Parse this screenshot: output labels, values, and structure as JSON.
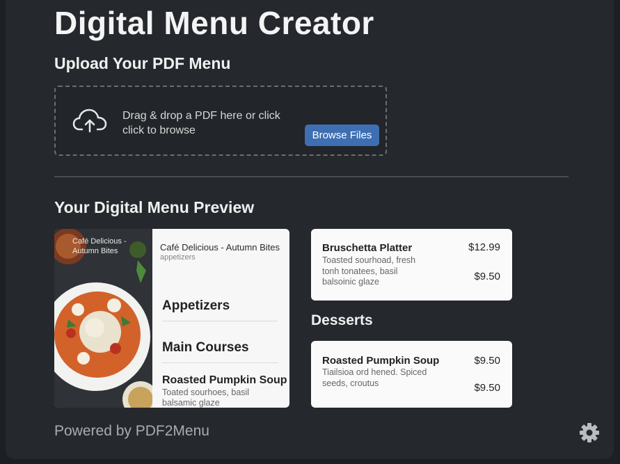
{
  "app": {
    "title": "Digital Menu Creator"
  },
  "upload": {
    "heading": "Upload Your PDF Menu",
    "drop_text": "Drag & drop a PDF here or click click to browse",
    "browse_label": "Browse Files",
    "icon": "cloud-upload-icon"
  },
  "preview": {
    "heading": "Your Digital Menu Preview",
    "image_caption": "Café Delicious - Autumn Bites",
    "menu_title": "Café Delicious - Autumn Bites",
    "menu_subtitle": "appetizers",
    "sections": [
      "Appetizers",
      "Main Courses"
    ],
    "item": {
      "name": "Roasted Pumpkin Soup",
      "desc": "Toated sourhoes, basil balsamic glaze"
    }
  },
  "cards": [
    {
      "name": "Bruschetta Platter",
      "price_top": "$12.99",
      "desc": "Toasted sourhoad, fresh tonh tonatees, basil balsoinic glaze",
      "price_bottom": "$9.50"
    },
    {
      "name": "Roasted Pumpkin Soup",
      "price_top": "$9.50",
      "desc": "Tiailsioa ord hened. Spiced seeds, croutus",
      "price_bottom": "$9.50"
    }
  ],
  "desserts_heading": "Desserts",
  "footer": {
    "text": "Powered by PDF2Menu",
    "settings_icon": "gear-icon"
  },
  "colors": {
    "background": "#25282d",
    "accent": "#3e6fb3",
    "card": "#fafafa"
  }
}
